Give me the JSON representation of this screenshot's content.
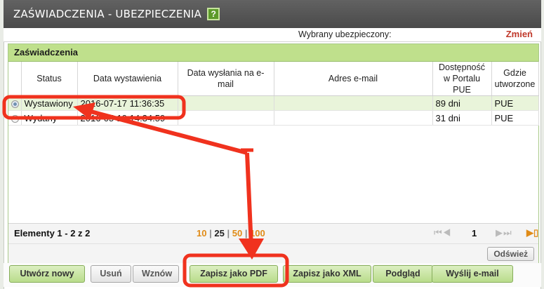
{
  "window": {
    "title": "ZAŚWIADCZENIA - UBEZPIECZENIA",
    "help_label": "?"
  },
  "insured": {
    "label": "Wybrany ubezpieczony:",
    "change_label": "Zmień"
  },
  "panel": {
    "title": "Zaświadczenia"
  },
  "table": {
    "headers": [
      "Status",
      "Data wystawienia",
      "Data wysłania na e-mail",
      "Adres e-mail",
      "Dostępność w Portalu PUE",
      "Gdzie utworzone"
    ],
    "rows": [
      {
        "selected": true,
        "status": "Wystawiony",
        "issued": "2016-07-17 11:36:35",
        "sent": "",
        "email": "",
        "availability": "89 dni",
        "where": "PUE"
      },
      {
        "selected": false,
        "status": "Wydany",
        "issued": "2016-05-19 14:34:59",
        "sent": "",
        "email": "",
        "availability": "31 dni",
        "where": "PUE"
      }
    ]
  },
  "pager": {
    "elements_label": "Elementy 1 - 2 z 2",
    "sizes": [
      "10",
      "25",
      "50",
      "100"
    ],
    "current_size": "25",
    "separator": "|",
    "first_prev_glyph": "⏮◀",
    "page": "1",
    "next_last_glyph": "▶⏭",
    "export_glyph": "▶▯"
  },
  "refresh_label": "Odśwież",
  "buttons": [
    "Utwórz nowy",
    "Usuń",
    "Wznów",
    "Zapisz jako PDF",
    "Zapisz jako XML",
    "Podgląd",
    "Wyślij e-mail"
  ],
  "colors": {
    "accent_green": "#bfe08c",
    "annotation_red": "#f0321e",
    "title_bar": "#555555",
    "link_orange": "#e08b17",
    "change_red": "#c0392b"
  }
}
